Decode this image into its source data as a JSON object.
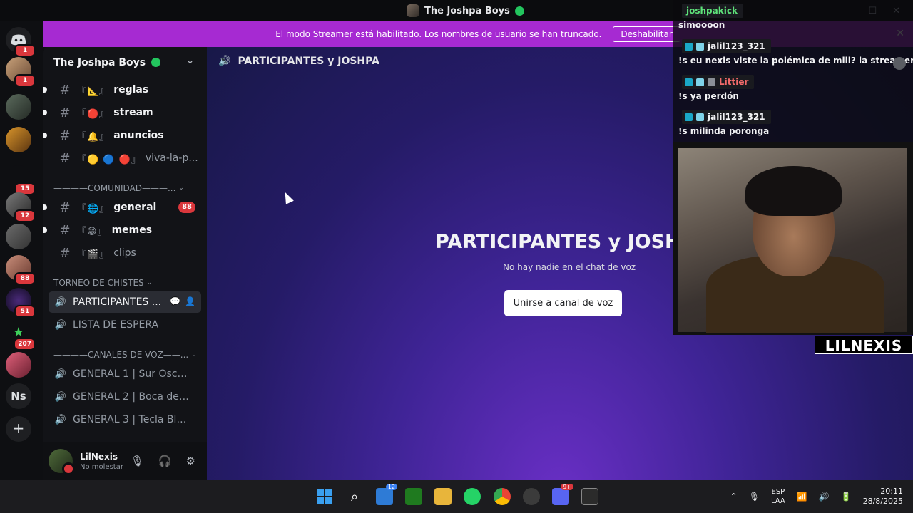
{
  "window": {
    "title": "The Joshpa Boys",
    "controls": [
      "—",
      "☐",
      "✕"
    ]
  },
  "banner": {
    "text": "El modo Streamer está habilitado. Los nombres de usuario se han truncado.",
    "button": "Deshabilitar"
  },
  "servers": [
    {
      "badge": "1"
    },
    {
      "badge": "1"
    },
    {
      "badge": ""
    },
    {
      "badge": ""
    },
    {
      "badge": "15"
    },
    {
      "badge": "12"
    },
    {
      "badge": ""
    },
    {
      "badge": "88"
    },
    {
      "badge": "51"
    },
    {
      "badge": "207"
    },
    {
      "badge": ""
    },
    {
      "badge": "",
      "label": "Ns"
    },
    {
      "badge": "",
      "label": "+"
    }
  ],
  "server": {
    "name": "The Joshpa Boys"
  },
  "channels": {
    "text_top": [
      {
        "emoji": "『📐』",
        "name": "reglas"
      },
      {
        "emoji": "『🔴』",
        "name": "stream"
      },
      {
        "emoji": "『🔔』",
        "name": "anuncios"
      },
      {
        "emoji": "『🟡 🔵 🔴』",
        "name": "viva-la-p..."
      }
    ],
    "cat_comunidad": "————COMUNIDAD———...",
    "comunidad": [
      {
        "emoji": "『🌐』",
        "name": "general",
        "badge": "88"
      },
      {
        "emoji": "『😁』",
        "name": "memes"
      },
      {
        "emoji": "『🎬』",
        "name": "clips"
      }
    ],
    "cat_torneo": "TORNEO DE CHISTES",
    "torneo": [
      {
        "name": "PARTICIPANTES ..."
      },
      {
        "name": "LISTA DE ESPERA"
      }
    ],
    "cat_voz": "————CANALES DE VOZ——...",
    "voz": [
      {
        "name": "GENERAL 1 | Sur Oscur..."
      },
      {
        "name": "GENERAL 2 | Boca del T..."
      },
      {
        "name": "GENERAL 3 | Tecla Blan..."
      }
    ]
  },
  "user": {
    "name": "LilNexis",
    "status": "No molestar"
  },
  "main": {
    "header": "PARTICIPANTES y JOSHPA",
    "title": "PARTICIPANTES y JOSHPA",
    "subtitle": "No hay nadie en el chat de voz",
    "join": "Unirse a canal de voz"
  },
  "chat": {
    "top_user": "joshpakick",
    "messages": [
      {
        "user": "",
        "text": "simoooon"
      },
      {
        "user": "jalil123_321",
        "text": "!s eu nexis viste la polémica de mili? la streamer"
      },
      {
        "user": "Littier",
        "text": "!s ya perdón"
      },
      {
        "user": "jalil123_321",
        "text": "!s milinda poronga"
      }
    ]
  },
  "cam_label": "LILNEXIS",
  "taskbar": {
    "store_badge": "12",
    "discord_badge": "9+",
    "lang1": "ESP",
    "lang2": "LAA",
    "time": "20:11",
    "date": "28/8/2025"
  },
  "colors": {
    "banner": "#a62ad2",
    "status_green": "#23c55e",
    "badge_red": "#da373c"
  }
}
